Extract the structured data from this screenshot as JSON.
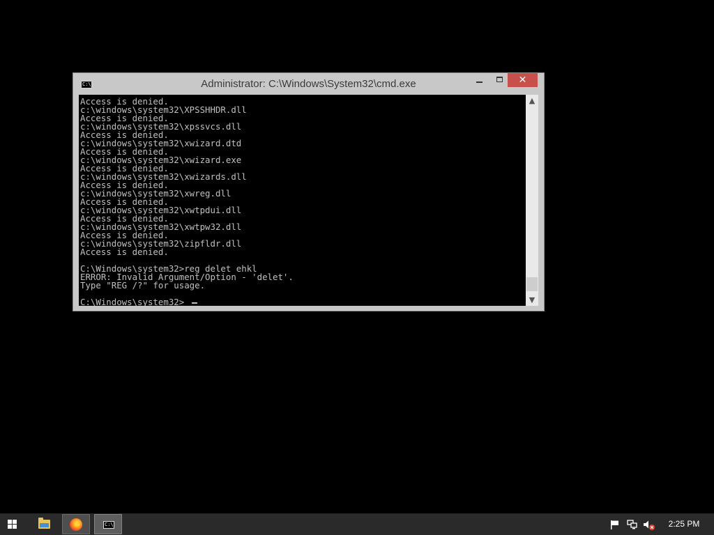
{
  "window": {
    "title": "Administrator: C:\\Windows\\System32\\cmd.exe",
    "icon_text": "C:\\",
    "controls": {
      "minimize": "minimize",
      "maximize": "maximize",
      "close": "✕"
    }
  },
  "console": {
    "lines": [
      "Access is denied.",
      "c:\\windows\\system32\\XPSSHHDR.dll",
      "Access is denied.",
      "c:\\windows\\system32\\xpssvcs.dll",
      "Access is denied.",
      "c:\\windows\\system32\\xwizard.dtd",
      "Access is denied.",
      "c:\\windows\\system32\\xwizard.exe",
      "Access is denied.",
      "c:\\windows\\system32\\xwizards.dll",
      "Access is denied.",
      "c:\\windows\\system32\\xwreg.dll",
      "Access is denied.",
      "c:\\windows\\system32\\xwtpdui.dll",
      "Access is denied.",
      "c:\\windows\\system32\\xwtpw32.dll",
      "Access is denied.",
      "c:\\windows\\system32\\zipfldr.dll",
      "Access is denied.",
      "",
      "C:\\Windows\\system32>reg delet ehkl",
      "ERROR: Invalid Argument/Option - 'delet'.",
      "Type \"REG /?\" for usage.",
      "",
      "C:\\Windows\\system32>"
    ],
    "text_color": "#c0c0c0",
    "background_color": "#000000"
  },
  "scrollbar": {
    "up_arrow": "▲",
    "down_arrow": "▼"
  },
  "taskbar": {
    "apps": [
      {
        "name": "File Explorer",
        "icon": "folder-icon"
      },
      {
        "name": "Firefox",
        "icon": "firefox-icon"
      },
      {
        "name": "Command Prompt",
        "icon": "cmd-icon",
        "icon_text": "C:\\",
        "active": true
      }
    ],
    "tray": {
      "icons": [
        "flag-icon",
        "network-icon",
        "volume-muted-icon"
      ],
      "clock": "2:25 PM"
    }
  }
}
